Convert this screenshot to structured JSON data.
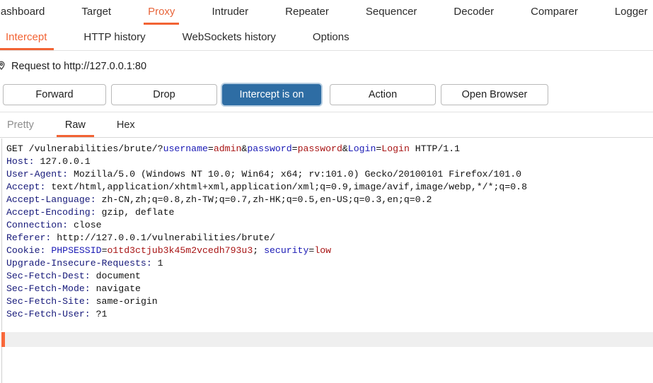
{
  "main_tabs": [
    {
      "label": "Dashboard",
      "active": false
    },
    {
      "label": "Target",
      "active": false
    },
    {
      "label": "Proxy",
      "active": true
    },
    {
      "label": "Intruder",
      "active": false
    },
    {
      "label": "Repeater",
      "active": false
    },
    {
      "label": "Sequencer",
      "active": false
    },
    {
      "label": "Decoder",
      "active": false
    },
    {
      "label": "Comparer",
      "active": false
    },
    {
      "label": "Logger",
      "active": false
    }
  ],
  "sub_tabs": [
    {
      "label": "Intercept",
      "active": true
    },
    {
      "label": "HTTP history",
      "active": false
    },
    {
      "label": "WebSockets history",
      "active": false
    },
    {
      "label": "Options",
      "active": false
    }
  ],
  "request_bar": {
    "icon": "location-pin-icon",
    "label": "Request to http://127.0.0.1:80"
  },
  "toolbar": {
    "forward_label": "Forward",
    "drop_label": "Drop",
    "intercept_label": "Intercept is on",
    "action_label": "Action",
    "open_browser_label": "Open Browser",
    "intercept_color": "#2e6da4"
  },
  "view_tabs": [
    {
      "label": "Pretty",
      "active": false
    },
    {
      "label": "Raw",
      "active": true
    },
    {
      "label": "Hex",
      "active": false
    }
  ],
  "request": {
    "method": "GET",
    "path": "/vulnerabilities/brute/?",
    "version": "HTTP/1.1",
    "query_params": [
      {
        "name": "username",
        "value": "admin"
      },
      {
        "name": "password",
        "value": "password"
      },
      {
        "name": "Login",
        "value": "Login"
      }
    ],
    "headers": [
      {
        "name": "Host",
        "value": "127.0.0.1"
      },
      {
        "name": "User-Agent",
        "value": "Mozilla/5.0 (Windows NT 10.0; Win64; x64; rv:101.0) Gecko/20100101 Firefox/101.0"
      },
      {
        "name": "Accept",
        "value": "text/html,application/xhtml+xml,application/xml;q=0.9,image/avif,image/webp,*/*;q=0.8"
      },
      {
        "name": "Accept-Language",
        "value": "zh-CN,zh;q=0.8,zh-TW;q=0.7,zh-HK;q=0.5,en-US;q=0.3,en;q=0.2"
      },
      {
        "name": "Accept-Encoding",
        "value": "gzip, deflate"
      },
      {
        "name": "Connection",
        "value": "close"
      },
      {
        "name": "Referer",
        "value": "http://127.0.0.1/vulnerabilities/brute/"
      }
    ],
    "cookie_header": {
      "name": "Cookie",
      "pairs": [
        {
          "name": "PHPSESSID",
          "value": "o1td3ctjub3k45m2vcedh793u3"
        },
        {
          "name": "security",
          "value": "low"
        }
      ]
    },
    "headers_after_cookie": [
      {
        "name": "Upgrade-Insecure-Requests",
        "value": "1"
      },
      {
        "name": "Sec-Fetch-Dest",
        "value": "document"
      },
      {
        "name": "Sec-Fetch-Mode",
        "value": "navigate"
      },
      {
        "name": "Sec-Fetch-Site",
        "value": "same-origin"
      },
      {
        "name": "Sec-Fetch-User",
        "value": "?1"
      }
    ]
  },
  "search": {
    "value": "",
    "placeholder": "",
    "marker_color": "#f9683a"
  }
}
